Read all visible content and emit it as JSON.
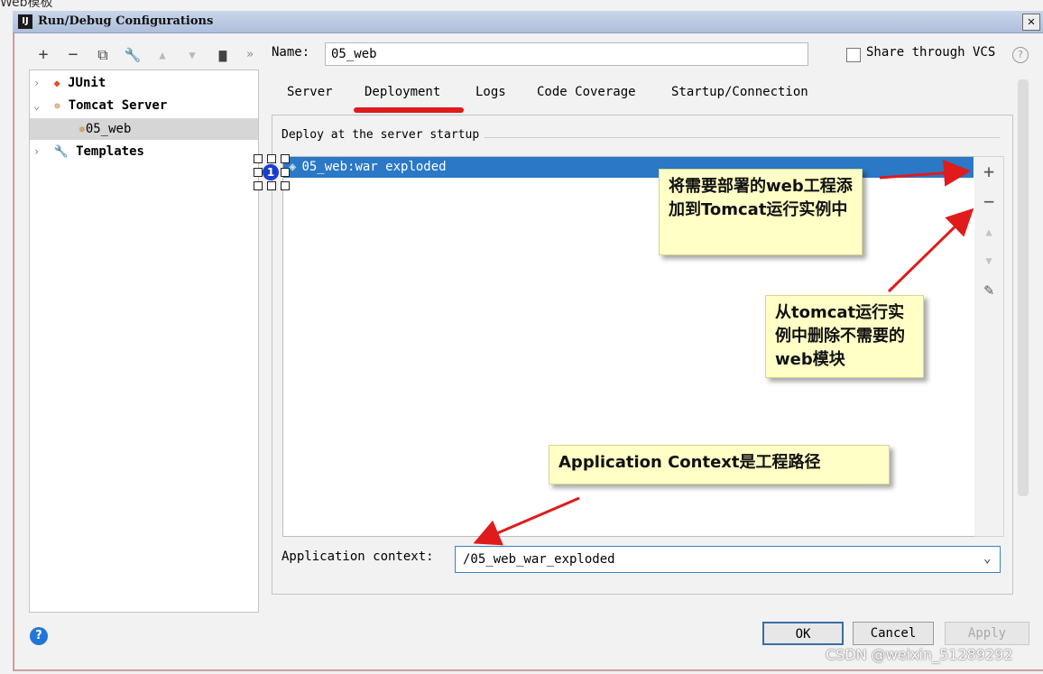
{
  "top_cut_text": "Web模板",
  "window": {
    "title": "Run/Debug Configurations",
    "app_icon": "IJ",
    "close": "✕"
  },
  "toolbar": {
    "add": "+",
    "remove": "−",
    "copy": "⧉",
    "edit": "🔧",
    "move_up": "▲",
    "move_down": "▼",
    "folder": "▆",
    "more": "»"
  },
  "tree": {
    "items": [
      {
        "label": "JUnit",
        "arrow": "›"
      },
      {
        "label": "Tomcat Server",
        "arrow": "⌄"
      },
      {
        "label": "05_web",
        "arrow": ""
      },
      {
        "label": "Templates",
        "arrow": "›"
      }
    ]
  },
  "name": {
    "label": "Name:",
    "value": "05_web"
  },
  "share": {
    "label": "Share through VCS",
    "checked": false,
    "help": "?"
  },
  "tabs": [
    {
      "label": "Server"
    },
    {
      "label": "Deployment",
      "active": true
    },
    {
      "label": "Logs"
    },
    {
      "label": "Code Coverage"
    },
    {
      "label": "Startup/Connection"
    }
  ],
  "deploy": {
    "section_title": "Deploy at the server startup",
    "items": [
      "05_web:war exploded"
    ],
    "badge": "1",
    "tools": {
      "add": "+",
      "remove": "−",
      "up": "▲",
      "down": "▼",
      "edit": "✎"
    }
  },
  "context": {
    "label": "Application context:",
    "value": "/05_web_war_exploded",
    "arrow": "⌄"
  },
  "buttons": {
    "ok": "OK",
    "cancel": "Cancel",
    "apply": "Apply",
    "help": "?"
  },
  "notes": {
    "add": "将需要部署的web工程添加到Tomcat运行实例中",
    "remove": "从tomcat运行实例中删除不需要的web模块",
    "context": "Application Context是工程路径"
  },
  "watermark": "CSDN @weixin_51289292",
  "colors": {
    "accent": "#2a78c6",
    "annotation_red": "#e01b1b",
    "note_bg": "#ffffc6"
  }
}
